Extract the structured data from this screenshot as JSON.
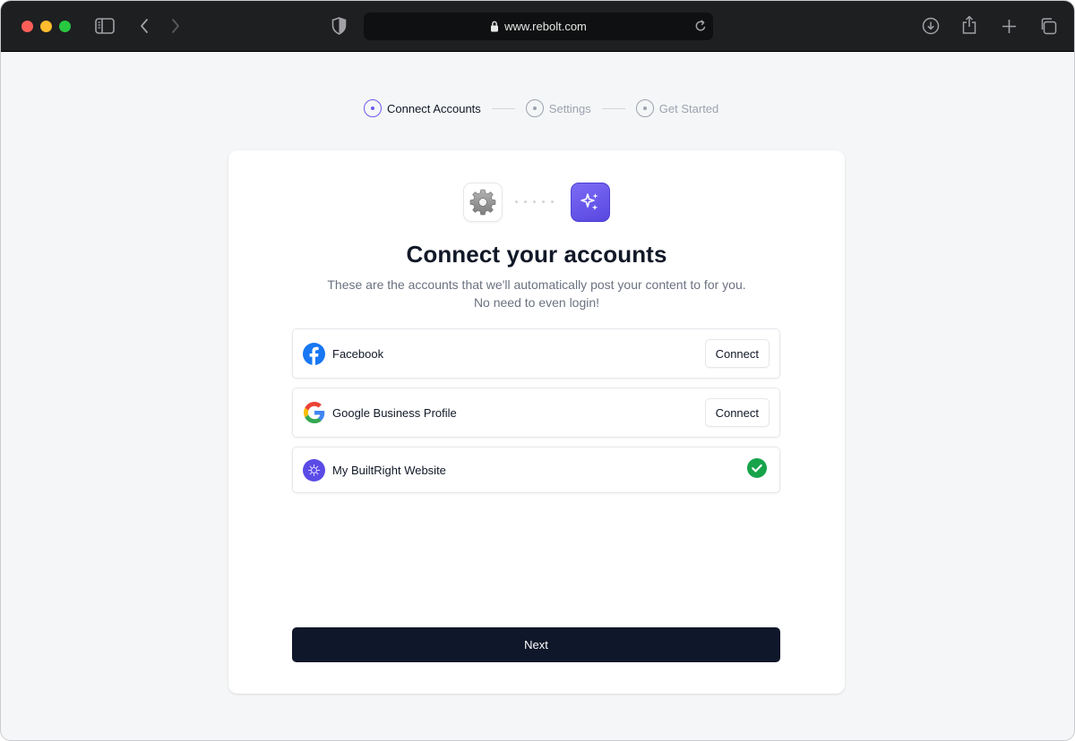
{
  "browser": {
    "url": "www.rebolt.com"
  },
  "stepper": {
    "steps": [
      {
        "label": "Connect Accounts",
        "active": true
      },
      {
        "label": "Settings",
        "active": false
      },
      {
        "label": "Get Started",
        "active": false
      }
    ]
  },
  "card": {
    "title": "Connect your accounts",
    "subtitle_line1": "These are the accounts that we'll automatically post your content to for you.",
    "subtitle_line2": "No need to even login!",
    "accounts": [
      {
        "name": "Facebook",
        "icon": "facebook-icon",
        "action": "Connect"
      },
      {
        "name": "Google Business Profile",
        "icon": "google-icon",
        "action": "Connect"
      },
      {
        "name": "My BuiltRight Website",
        "icon": "builtright-icon",
        "status": "connected"
      }
    ],
    "next_label": "Next"
  },
  "colors": {
    "accent": "#6b5cf0",
    "primary_button": "#0f172a",
    "success": "#16a34a",
    "facebook": "#1877f2"
  }
}
